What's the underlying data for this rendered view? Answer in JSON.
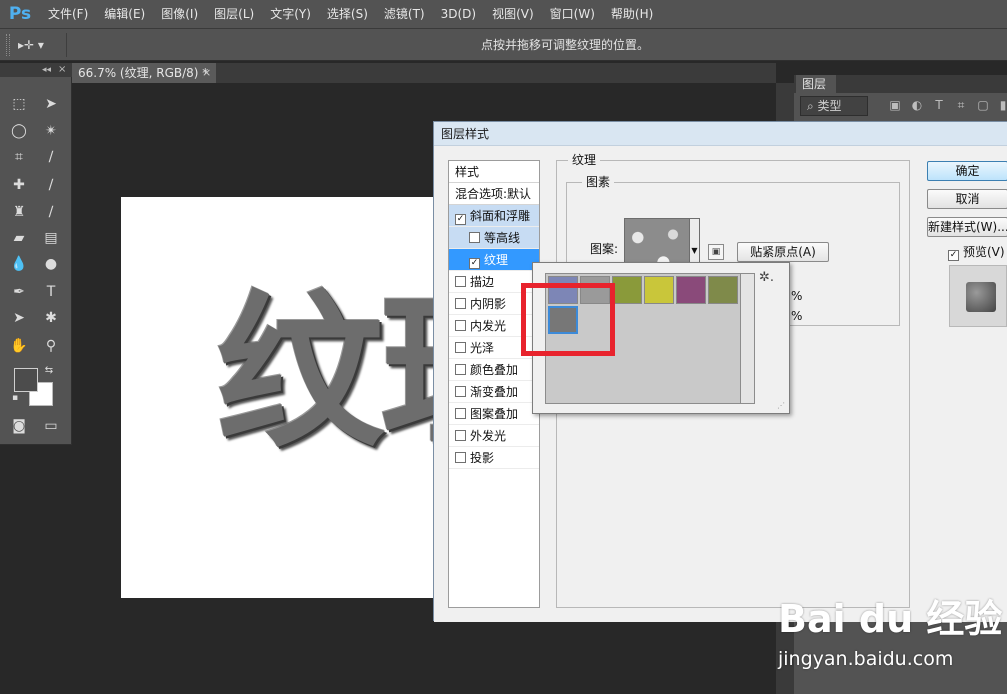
{
  "app": {
    "logo": "Ps",
    "menu": [
      "文件(F)",
      "编辑(E)",
      "图像(I)",
      "图层(L)",
      "文字(Y)",
      "选择(S)",
      "滤镜(T)",
      "3D(D)",
      "视图(V)",
      "窗口(W)",
      "帮助(H)"
    ]
  },
  "options_bar": {
    "tool": "▸✛ ▾",
    "hint": "点按并拖移可调整纹理的位置。"
  },
  "document": {
    "tab_title": "66.7% (纹理, RGB/8) *",
    "tab_close": "×",
    "canvas_text": "纹理"
  },
  "tool_panel": {
    "collapse": "◂◂",
    "close": "×"
  },
  "layers_panel": {
    "tab_label": "图层",
    "filter_label": "⌕ 类型"
  },
  "layer_style_dialog": {
    "title": "图层样式",
    "styles_header": "样式",
    "blend_options": "混合选项:默认",
    "styles": [
      {
        "label": "斜面和浮雕",
        "checked": true,
        "sub": false
      },
      {
        "label": "等高线",
        "checked": false,
        "sub": true
      },
      {
        "label": "纹理",
        "checked": true,
        "sub": true
      },
      {
        "label": "描边",
        "checked": false,
        "sub": false
      },
      {
        "label": "内阴影",
        "checked": false,
        "sub": false
      },
      {
        "label": "内发光",
        "checked": false,
        "sub": false
      },
      {
        "label": "光泽",
        "checked": false,
        "sub": false
      },
      {
        "label": "颜色叠加",
        "checked": false,
        "sub": false
      },
      {
        "label": "渐变叠加",
        "checked": false,
        "sub": false
      },
      {
        "label": "图案叠加",
        "checked": false,
        "sub": false
      },
      {
        "label": "外发光",
        "checked": false,
        "sub": false
      },
      {
        "label": "投影",
        "checked": false,
        "sub": false
      }
    ],
    "texture_group_label": "纹理",
    "elements_group_label": "图素",
    "pattern_label": "图案:",
    "snap_button": "贴紧原点(A)",
    "percent_1": "%",
    "percent_2": "%",
    "ok_button": "确定",
    "cancel_button": "取消",
    "new_style_button": "新建样式(W)...",
    "preview_label": "预览(V)",
    "preview_checked": true
  },
  "pattern_picker": {
    "gear": "✲.",
    "swatch_colors": [
      "#7d86b6",
      "#9a9a9a",
      "#8a9a3a",
      "#c9c63a",
      "#8a4a7a",
      "#7f8a4a",
      "#7a7a7a"
    ]
  },
  "watermark": {
    "logo": "Bai du 经验",
    "url": "jingyan.baidu.com"
  },
  "colors": {
    "accent_selected": "#3399ff",
    "annotation_red": "#e8232d",
    "ps_blue": "#4fb0f0"
  }
}
